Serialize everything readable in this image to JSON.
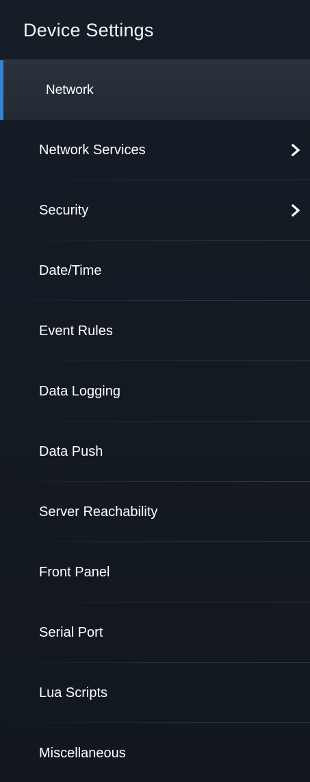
{
  "header": {
    "title": "Device Settings"
  },
  "menu": {
    "items": [
      {
        "label": "Network",
        "active": true,
        "has_submenu": false
      },
      {
        "label": "Network Services",
        "active": false,
        "has_submenu": true
      },
      {
        "label": "Security",
        "active": false,
        "has_submenu": true
      },
      {
        "label": "Date/Time",
        "active": false,
        "has_submenu": false
      },
      {
        "label": "Event Rules",
        "active": false,
        "has_submenu": false
      },
      {
        "label": "Data Logging",
        "active": false,
        "has_submenu": false
      },
      {
        "label": "Data Push",
        "active": false,
        "has_submenu": false
      },
      {
        "label": "Server Reachability",
        "active": false,
        "has_submenu": false
      },
      {
        "label": "Front Panel",
        "active": false,
        "has_submenu": false
      },
      {
        "label": "Serial Port",
        "active": false,
        "has_submenu": false
      },
      {
        "label": "Lua Scripts",
        "active": false,
        "has_submenu": false
      },
      {
        "label": "Miscellaneous",
        "active": false,
        "has_submenu": false
      }
    ]
  },
  "colors": {
    "background": "#151b24",
    "active_item": "#2a323d",
    "accent": "#2f86d6",
    "text": "#ffffff"
  }
}
